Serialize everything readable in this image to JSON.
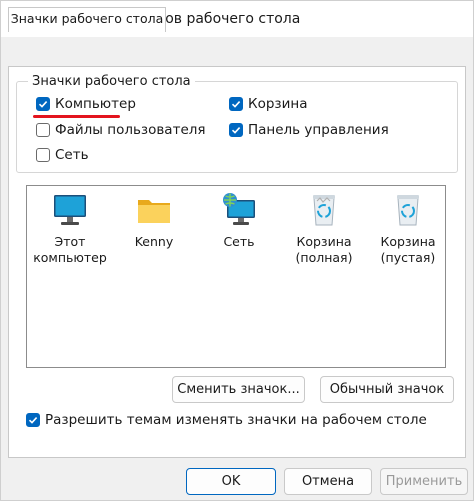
{
  "window": {
    "title": "Параметры значков рабочего стола"
  },
  "tabs": [
    {
      "label": "Значки рабочего стола"
    }
  ],
  "group": {
    "legend": "Значки рабочего стола",
    "checkboxes": [
      {
        "label": "Компьютер",
        "checked": true
      },
      {
        "label": "Корзина",
        "checked": true
      },
      {
        "label": "Файлы пользователя",
        "checked": false
      },
      {
        "label": "Панель управления",
        "checked": true
      },
      {
        "label": "Сеть",
        "checked": false
      }
    ]
  },
  "icons": [
    {
      "label": "Этот компьютер",
      "icon": "monitor-icon"
    },
    {
      "label": "Kenny",
      "icon": "folder-icon"
    },
    {
      "label": "Сеть",
      "icon": "network-icon"
    },
    {
      "label": "Корзина (полная)",
      "icon": "recycle-bin-full-icon"
    },
    {
      "label": "Корзина (пустая)",
      "icon": "recycle-bin-empty-icon"
    }
  ],
  "buttons": {
    "change_icon": "Сменить значок...",
    "default_icon": "Обычный значок",
    "ok": "OK",
    "cancel": "Отмена",
    "apply": "Применить"
  },
  "allow_themes": {
    "label": "Разрешить темам изменять значки на рабочем столе",
    "checked": true
  },
  "colors": {
    "accent": "#0067c0",
    "annotation_underline": "#e3141e"
  }
}
